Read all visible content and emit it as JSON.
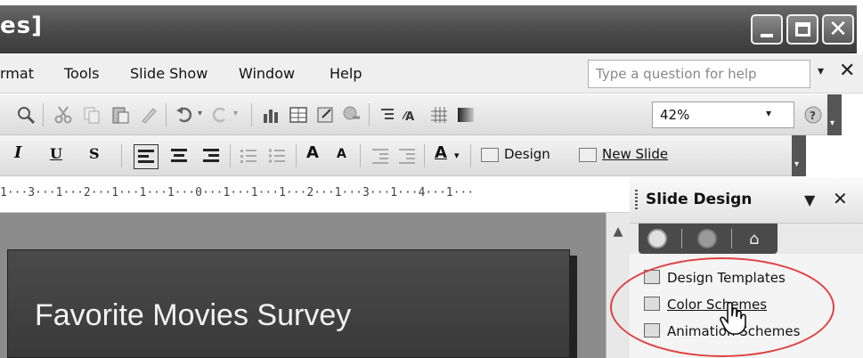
{
  "window": {
    "title_fragment": "es]",
    "buttons": {
      "minimize": "_",
      "maximize": "□",
      "close": "✕"
    }
  },
  "menubar": {
    "items": [
      "rmat",
      "Tools",
      "Slide Show",
      "Window",
      "Help"
    ],
    "help_placeholder": "Type a question for help",
    "help_dropdown": "▾",
    "close": "✕"
  },
  "toolbar_standard": {
    "zoom_value": "42%",
    "zoom_dropdown": "▾"
  },
  "toolbar_formatting": {
    "italic": "I",
    "underline": "U",
    "shadow": "S",
    "increase_font": "A",
    "decrease_font": "A",
    "font_color": "A",
    "design_label": "Design",
    "new_slide_label": "New Slide"
  },
  "ruler": {
    "text": "1···3···1···2···1···1···1···0···1···1···1···2···1···3···1···4···1···"
  },
  "slide": {
    "title": "Favorite Movies Survey"
  },
  "taskpane": {
    "title": "Slide Design",
    "menu_arrow": "▼",
    "close": "✕",
    "links": {
      "design_templates": "Design Templates",
      "color_schemes": "Color Schemes",
      "animation_schemes": "Animation Schemes"
    }
  },
  "colors": {
    "titlebar": "#4e4e4e",
    "highlight": "#e04040",
    "slide_bg": "#3f3f3f"
  }
}
